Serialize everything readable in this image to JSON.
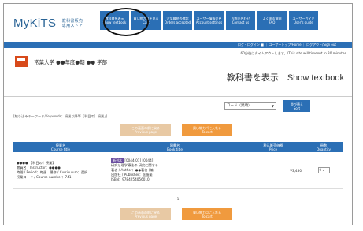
{
  "header": {
    "logo_main": "MyKiTS",
    "logo_sub_1": "教科書販売",
    "logo_sub_2": "専用ストア",
    "nav": [
      {
        "jp": "教科書を表示",
        "en": "Show textbook"
      },
      {
        "jp": "買い物カゴを見る",
        "en": "Cart"
      },
      {
        "jp": "注文履歴の確認",
        "en": "Orders accepted"
      },
      {
        "jp": "ユーザー情報変更",
        "en": "Account settings"
      },
      {
        "jp": "お問い合わせ",
        "en": "Contact us"
      },
      {
        "jp": "よくある質問",
        "en": "FAQ"
      },
      {
        "jp": "ユーザーガイド",
        "en": "User's guide"
      }
    ],
    "bar_links": "ログ・ログイン ■ ｜ ユーザートップ/Home ｜ ログアウト/Sign out"
  },
  "timeout_notice": "60分後にタイムアウトします。/This site will timeout in 30 minutes.",
  "university": "常葉大学 ●●年度●期 ●● 学部",
  "page_title": "教科書を表示　Show textbook",
  "sort": {
    "selected": "コード（昇順）",
    "button_jp": "並び替え",
    "button_en": "Sort"
  },
  "keywords_text": "[絞り込みキーワード/Keywords：授業以降等［科目の］授業」]",
  "pager_buttons": {
    "prev_jp": "この画面の前に戻る",
    "prev_en": "Previous page",
    "cart_jp": "買い物カゴに入れる",
    "cart_en": "To cart"
  },
  "table": {
    "headers": [
      {
        "jp": "授業名",
        "en": "Course title"
      },
      {
        "jp": "図書名",
        "en": "Book title"
      },
      {
        "jp": "税込販売価格",
        "en": "Price"
      },
      {
        "jp": "冊数",
        "en": "Quantity"
      }
    ],
    "rows": [
      {
        "course_lines": [
          "●●●● 【科目の】授業】",
          "教員名 / Instructor：●●●●",
          "時間 / Period：毎週　履修 / Curriculum：選択",
          "授業コード / Course number：741"
        ],
        "badge": "新刊本",
        "book_title": "[0044-01] [0044]",
        "book_lines": [
          "研究と理学療法の 研究に関する",
          "著者 / Author：●●著名 (編)",
          "出版社 / Publisher：医歯薬",
          "ISBN：9784254056010"
        ],
        "price": "¥3,480",
        "quantity": "0"
      }
    ]
  },
  "page_number": "1"
}
